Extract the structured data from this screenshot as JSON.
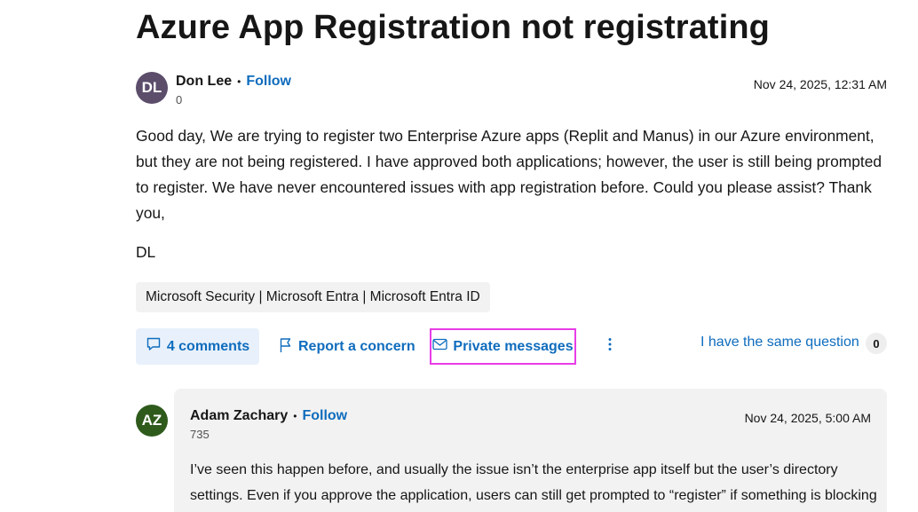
{
  "question": {
    "title": "Azure App Registration not registrating",
    "author": {
      "initials": "DL",
      "name": "Don Lee",
      "separator": "•",
      "follow_label": "Follow",
      "reputation": "0",
      "avatar_color": "#5c4d6b"
    },
    "timestamp": "Nov 24, 2025, 12:31 AM",
    "body": "Good day, We are trying to register two Enterprise Azure apps (Replit and Manus) in our Azure environment, but they are not being registered. I have approved both applications; however, the user is still being prompted to register. We have never encountered issues with app registration before. Could you please assist? Thank you,",
    "signature": "DL",
    "tags": "Microsoft Security | Microsoft Entra | Microsoft Entra ID"
  },
  "actions": {
    "comments_label": "4 comments",
    "comments_icon": "comment-icon",
    "report_label": "Report a concern",
    "report_icon": "flag-icon",
    "private_messages_label": "Private messages",
    "private_messages_icon": "mail-icon",
    "more_icon": "more-vertical-icon",
    "same_question_label": "I have the same question",
    "same_question_count": "0"
  },
  "answer": {
    "author": {
      "initials": "AZ",
      "name": "Adam Zachary",
      "separator": "•",
      "follow_label": "Follow",
      "reputation": "735",
      "avatar_color": "#2e5a1c"
    },
    "timestamp": "Nov 24, 2025, 5:00 AM",
    "body": "I’ve seen this happen before, and usually the issue isn’t the enterprise app itself but the user’s directory settings. Even if you approve the application, users can still get prompted to “register” if something is blocking"
  },
  "colors": {
    "link": "#0f6cbd",
    "highlight_border": "#e83ce8",
    "comments_bg": "#e8f1fb",
    "card_bg": "#f2f2f2"
  }
}
